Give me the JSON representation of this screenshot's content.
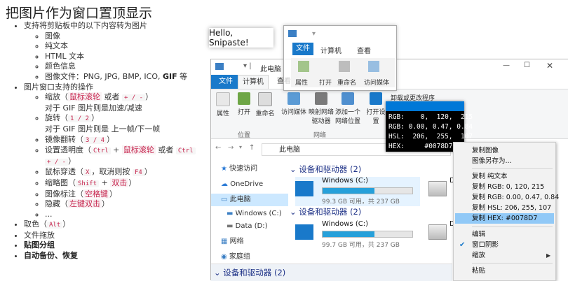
{
  "doc": {
    "title": "把图片作为窗口置顶显示",
    "i1": "支持将剪贴板中的以下内容转为图片",
    "i1_subs": [
      "图像",
      "纯文本",
      "HTML 文本",
      "颜色信息"
    ],
    "i1_s5_a": "图像文件：PNG, JPG, BMP, ICO, ",
    "i1_s5_b": "GIF",
    "i1_s5_c": " 等",
    "i2": "图片窗口支持的操作",
    "zoom_a": "缩放（",
    "zoom_wheel": "鼠标滚轮",
    "zoom_or": " 或者 ",
    "zoom_keys": "+ / -",
    "zoom_end": "）",
    "gif_zoom": "对于 GIF 图片则是加速/减速",
    "rotate_a": "旋转（",
    "rotate_keys": "1 / 2",
    "rotate_end": "）",
    "gif_rotate": "对于 GIF 图片则是 上一帧/下一帧",
    "flip_a": "镜像翻转（",
    "flip_keys": "3 / 4",
    "flip_end": "）",
    "opacity_a": "设置透明度（",
    "opacity_k1": "Ctrl",
    "opacity_plus": " + ",
    "opacity_wheel": "鼠标滚轮",
    "opacity_or": " 或者 ",
    "opacity_k2": "Ctrl",
    "opacity_line2_keys": "+ / -",
    "opacity_end": "）",
    "through_a": "鼠标穿透（",
    "through_k1": "X",
    "through_mid": "，取消则按 ",
    "through_k2": "F4",
    "through_end": "）",
    "thumb_a": "缩略图（",
    "thumb_k1": "Shift",
    "thumb_plus": " + ",
    "thumb_k2": "双击",
    "thumb_end": "）",
    "annot_a": "图像标注（",
    "annot_k": "空格键",
    "annot_end": "）",
    "hide_a": "隐藏（",
    "hide_k": "左键双击",
    "hide_end": "）",
    "ellipsis": "...",
    "pick_a": "取色（",
    "pick_k": "Alt",
    "pick_end": "）",
    "drag": "文件拖放",
    "group": "贴图分组",
    "backup": "自动备份、恢复"
  },
  "snip_text": "Hello, Snipaste!",
  "ghost": {
    "tab_file": "文件",
    "tab_computer": "计算机",
    "tab_view": "查看",
    "btn1": "属性",
    "btn2": "打开",
    "btn3": "重命名",
    "btn4": "访问媒体"
  },
  "explorer": {
    "title": "此电脑",
    "tab_file": "文件",
    "tab_computer": "计算机",
    "tab_view": "查看",
    "ribbon": [
      "属性",
      "打开",
      "重命名",
      "访问媒体",
      "映射网络驱动器",
      "添加一个网络位置",
      "打开设置"
    ],
    "ribbon_uninstall": "卸载或更改程序",
    "group_location": "位置",
    "group_network": "网络",
    "address": "此电脑",
    "nav": [
      "快速访问",
      "OneDrive",
      "此电脑",
      "Windows (C:)",
      "Data (D:)",
      "网络",
      "家庭组"
    ],
    "section": "设备和驱动器 (2)",
    "drives": [
      {
        "name": "Windows (C:)",
        "size": "99.3 GB 可用，共 237 GB",
        "used": 0.58
      },
      {
        "name": "Windows (C:)",
        "size": "99.7 GB 可用，共 237 GB",
        "used": 0.58
      }
    ],
    "partial_drive": "D"
  },
  "picker": {
    "color": "#0078D7",
    "rgb": "RGB:    0,  120,  215",
    "rgbf": "RGB: 0.00, 0.47, 0.84",
    "hsl": "HSL:  206,  255,  107",
    "hex": "HEX:     #0078D7"
  },
  "menu": {
    "items": [
      "复制图像",
      "图像另存为...",
      "复制 纯文本",
      "复制 RGB: 0, 120, 215",
      "复制 RGB: 0.00, 0.47, 0.84",
      "复制 HSL: 206, 255, 107",
      "复制 HEX: #0078D7",
      "编辑",
      "窗口阴影",
      "缩放",
      "粘贴"
    ],
    "highlight_color": "#91c9f7"
  }
}
